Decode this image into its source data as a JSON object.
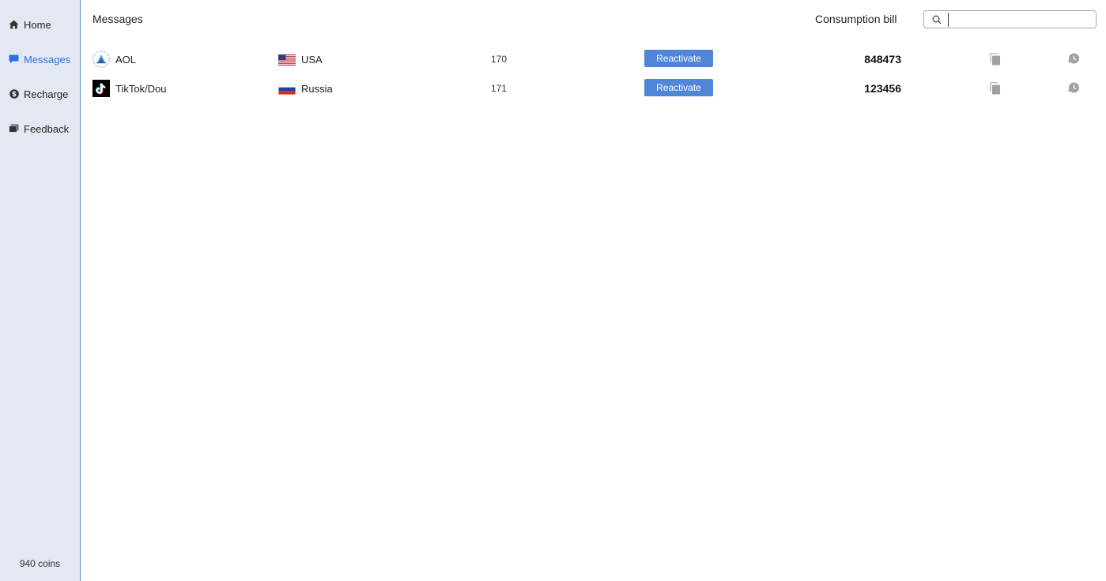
{
  "sidebar": {
    "items": [
      {
        "label": "Home",
        "icon": "home-icon",
        "active": false
      },
      {
        "label": "Messages",
        "icon": "message-icon",
        "active": true
      },
      {
        "label": "Recharge",
        "icon": "dollar-icon",
        "active": false
      },
      {
        "label": "Feedback",
        "icon": "feedback-icon",
        "active": false
      }
    ],
    "coins": "940 coins"
  },
  "header": {
    "title": "Messages",
    "bill_label": "Consumption bill",
    "search_value": "",
    "search_placeholder": ""
  },
  "colors": {
    "accent": "#2f6fdd",
    "button": "#4f86d8",
    "sidebar_bg": "#e4e8f2"
  },
  "rows": [
    {
      "service": "AOL",
      "service_icon": "aol-icon",
      "country": "USA",
      "flag": "usa-flag-icon",
      "count": "170",
      "action_label": "Reactivate",
      "code": "848473"
    },
    {
      "service": "TikTok/Dou",
      "service_icon": "tiktok-icon",
      "country": "Russia",
      "flag": "russia-flag-icon",
      "count": "171",
      "action_label": "Reactivate",
      "code": "123456"
    }
  ]
}
